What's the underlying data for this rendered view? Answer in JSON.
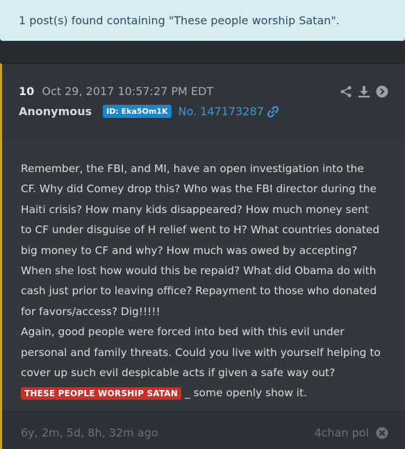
{
  "alert": {
    "text": "1 post(s) found containing \"These people worship Satan\"."
  },
  "post": {
    "number": "10",
    "timestamp": "Oct 29, 2017 10:57:27 PM EDT",
    "author": "Anonymous",
    "id_badge": "ID: Eka5Om1K",
    "post_no": "No. 147173287",
    "body": {
      "paragraph1": "Remember, the FBI, and MI, have an open investigation into the CF. Why did Comey drop this? Who was the FBI director during the Haiti crisis? How many kids disappeared? How much money sent to CF under disguise of H relief went to H? What countries donated big money to CF and why? How much was owed by accepting? When she lost how would this be repaid? What did Obama do with cash just prior to leaving office? Repayment to those who donated for favors/access? Dig!!!!!",
      "paragraph2": "Again, good people were forced into bed with this evil under personal and family threats. Could you live with yourself helping to cover up such evil despicable acts if given a safe way out?",
      "highlight": "THESE PEOPLE WORSHIP SATAN",
      "after_highlight": " _ some openly show it."
    },
    "age": "6y, 2m, 5d, 8h, 32m ago",
    "source": "4chan pol"
  },
  "colors": {
    "alert_bg": "#d9ecf1",
    "accent_border": "#c7a52c",
    "id_badge": "#1a87c8",
    "link": "#3a9ad9",
    "highlight": "#c9302c"
  },
  "icons": [
    "share-icon",
    "download-icon",
    "arrow-right-circle-icon",
    "link-icon",
    "close-circle-icon"
  ]
}
